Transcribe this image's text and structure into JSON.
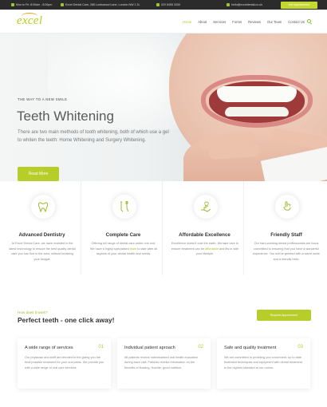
{
  "topbar": {
    "hours": "Mon to Fri: 8:00am - 8:00pm",
    "address": "Excel Dental Care, 288 Lordswood Lane, London NW 1 2L",
    "phone": "020 8455 3330",
    "email": "hello@exceldental.co.uk",
    "cta_label": "Get Appointment"
  },
  "header": {
    "logo_text": "excel",
    "nav": [
      "Home",
      "About",
      "Services",
      "Forms",
      "Reviews",
      "Our Team",
      "Contact Us"
    ],
    "active_nav": "Home"
  },
  "hero": {
    "subtitle": "THE WAY TO A NEW SMILE",
    "title": "Teeth Whitening",
    "text": "There are two main methods of tooth whitening, both of which use a gel to whiten the teeth: Home Whitening and Surgery Whitening.",
    "button_label": "Read More"
  },
  "features": [
    {
      "title": "Advanced Dentistry",
      "text": "At Excel Dental Care, we have invested in the latest technology to ensure the best quality dental care you can find in the area, without breaking your budget.",
      "icon": "tooth-icon"
    },
    {
      "title": "Complete Care",
      "text_before": "Offering full range of dental care under one roof. We have a highly specialised ",
      "text_highlight": "team",
      "text_after": " to take after all aspects of your dental health and needs.",
      "icon": "dental-tools-icon"
    },
    {
      "title": "Affordable Excellence",
      "text_before": "Excellence doesn't cost the earth. We take care to ensure treatment can be ",
      "text_highlight": "affordable",
      "text_after": " and fits in with your lifestyle.",
      "icon": "hand-tooth-icon"
    },
    {
      "title": "Friendly Staff",
      "text": "Our hard-working dental professionals are focus committed to ensuring that you have a wonderful experience. You will be greeted with a warm smile and a friendly hello.",
      "icon": "smile-icon"
    }
  ],
  "how": {
    "subtitle": "How does it work?",
    "title": "Perfect teeth - one click away!",
    "button_label": "Request Appointment",
    "cards": [
      {
        "title": "A wide range of services",
        "number": "01",
        "text": "Our physician and staff are devoted to the giving you the best possible treatment for your oral pains. We provide you with a wide range of oral care services."
      },
      {
        "title": "Individual patient aproach",
        "number": "02",
        "text": "All patients receive individualized oral health education during each visit. Patients receive information on the benefits of flossing, fluoride, good nutrition."
      },
      {
        "title": "Safe and quality treatment",
        "number": "03",
        "text": "We are committed to providing you convenient, up to date treatment techniques and equipment with dental treatment to the highest standard at our rooms."
      }
    ]
  },
  "colors": {
    "accent": "#b6cd2a",
    "logo_arc": "#e8a21b",
    "topbar_bg": "#2b2b2b"
  }
}
